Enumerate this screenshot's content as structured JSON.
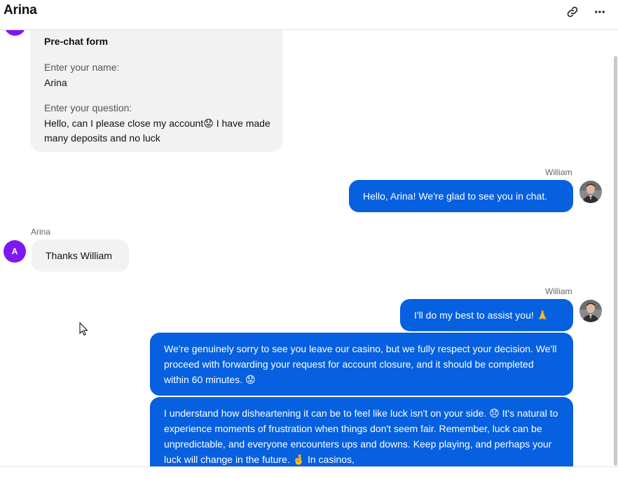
{
  "header": {
    "title": "Arina",
    "link_icon": "link-icon",
    "more_icon": "more-horizontal-icon"
  },
  "prechat": {
    "title": "Pre-chat form",
    "name_label": "Enter your name:",
    "name_value": "Arina",
    "question_label": "Enter your question:",
    "question_value": "Hello, can I please close my account😟 I have made many deposits and no luck"
  },
  "messages": [
    {
      "author": "William",
      "side": "out",
      "text": "Hello, Arina! We're glad to see you in chat."
    },
    {
      "author": "Arina",
      "side": "in",
      "avatar_initial": "A",
      "text": "Thanks William"
    },
    {
      "author": "William",
      "side": "out",
      "text": "I'll do my best to assist you! 🙏"
    },
    {
      "side": "out",
      "text": "We're genuinely sorry to see you leave our casino, but we fully respect your decision. We'll proceed with forwarding your request for account closure, and it should be completed within 60 minutes. 😟"
    },
    {
      "side": "out",
      "text": "I understand how disheartening it can be to feel like luck isn't on your side. 😞 It's natural to experience moments of frustration when things don't seem fair. Remember, luck can be unpredictable, and everyone encounters ups and downs. Keep playing, and perhaps your luck will change in the future. 🤞 In casinos,"
    }
  ],
  "colors": {
    "operator_bubble": "#0660e0",
    "visitor_bubble": "#f2f2f2",
    "visitor_avatar": "#7e18f0"
  }
}
